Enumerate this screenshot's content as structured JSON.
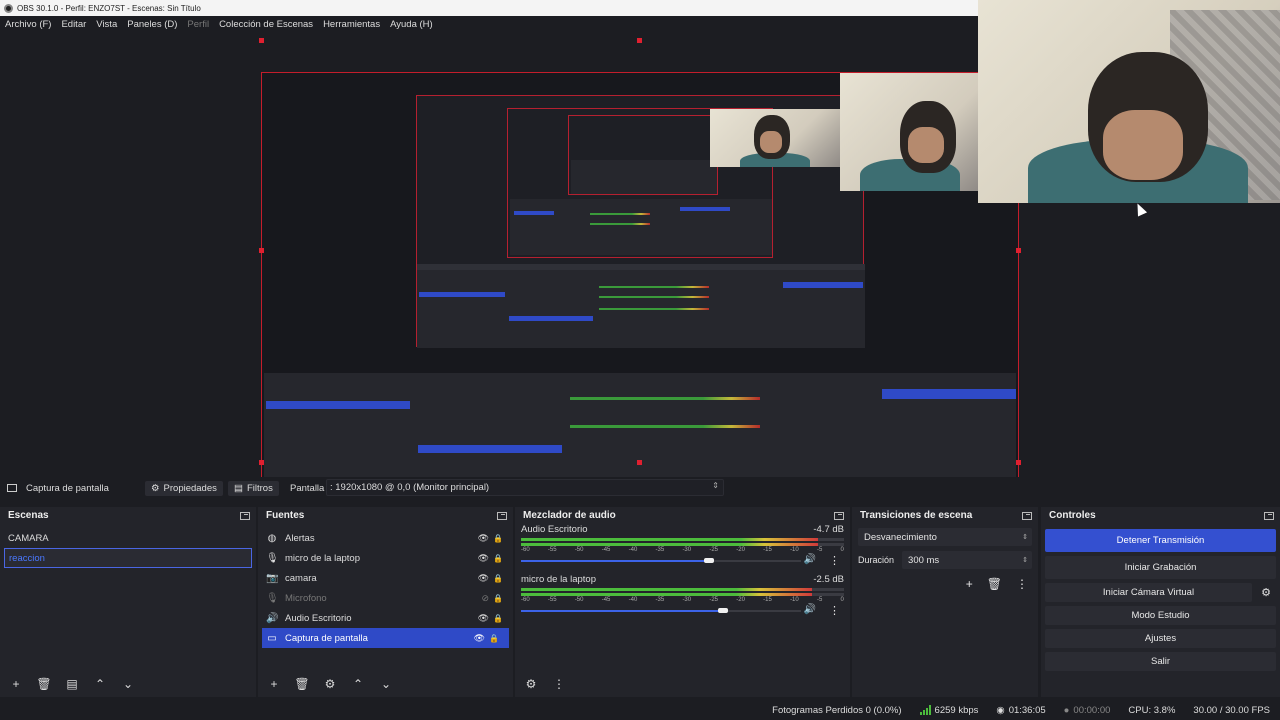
{
  "window": {
    "title": "OBS 30.1.0 - Perfil: ENZO7ST - Escenas: Sin Título"
  },
  "menu": {
    "items": [
      "Archivo (F)",
      "Editar",
      "Vista",
      "Paneles (D)",
      "Perfil",
      "Colección de Escenas",
      "Herramientas",
      "Ayuda (H)"
    ]
  },
  "source_toolbar": {
    "source_name": "Captura de pantalla",
    "properties_label": "Propiedades",
    "filters_label": "Filtros",
    "display_label": "Pantalla",
    "display_value": ": 1920x1080 @ 0,0 (Monitor principal)"
  },
  "scenes": {
    "title": "Escenas",
    "items": [
      {
        "label": "CAMARA"
      },
      {
        "label": "reaccion"
      }
    ]
  },
  "sources": {
    "title": "Fuentes",
    "items": [
      {
        "label": "Alertas",
        "icon": "globe-icon"
      },
      {
        "label": "micro de la laptop",
        "icon": "microphone-icon"
      },
      {
        "label": "camara",
        "icon": "camera-icon"
      },
      {
        "label": "Microfono",
        "icon": "microphone-icon"
      },
      {
        "label": "Audio Escritorio",
        "icon": "speaker-icon"
      },
      {
        "label": "Captura de pantalla",
        "icon": "monitor-icon"
      }
    ]
  },
  "mixer": {
    "title": "Mezclador de audio",
    "ticks": [
      "-60",
      "-55",
      "-50",
      "-45",
      "-40",
      "-35",
      "-30",
      "-25",
      "-20",
      "-15",
      "-10",
      "-5",
      "0"
    ],
    "channels": [
      {
        "name": "Audio Escritorio",
        "db": "-4.7 dB",
        "level": 0.92,
        "volume": 0.67
      },
      {
        "name": "micro de la laptop",
        "db": "-2.5 dB",
        "level": 0.9,
        "volume": 0.72
      }
    ]
  },
  "transitions": {
    "title": "Transiciones de escena",
    "selected": "Desvanecimiento",
    "duration_label": "Duración",
    "duration_value": "300 ms"
  },
  "controls": {
    "title": "Controles",
    "stop_stream": "Detener Transmisión",
    "start_recording": "Iniciar Grabación",
    "start_virtual_cam": "Iniciar Cámara Virtual",
    "studio_mode": "Modo Estudio",
    "settings": "Ajustes",
    "exit": "Salir"
  },
  "status": {
    "dropped_frames": "Fotogramas Perdidos 0 (0.0%)",
    "bitrate": "6259 kbps",
    "stream_time": "01:36:05",
    "record_time": "00:00:00",
    "cpu": "CPU: 3.8%",
    "fps": "30.00 / 30.00 FPS"
  },
  "colors": {
    "accent": "#3450d0",
    "selection_border": "#c41d2b",
    "background": "#1c1d22"
  }
}
